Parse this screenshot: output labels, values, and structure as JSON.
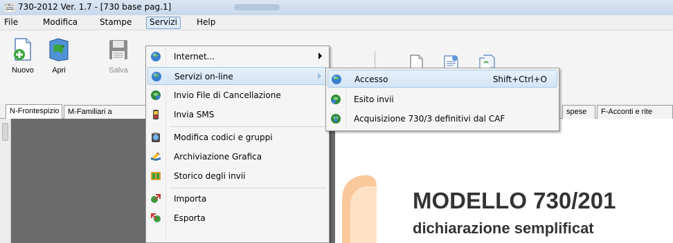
{
  "window": {
    "title": "730-2012 Ver. 1.7 - [730 base pag.1]"
  },
  "menubar": {
    "items": [
      {
        "label": "File"
      },
      {
        "label": "Modifica"
      },
      {
        "label": "Stampe"
      },
      {
        "label": "Servizi"
      },
      {
        "label": "Help"
      }
    ]
  },
  "toolbar": {
    "nuovo": "Nuovo",
    "apri": "Apri",
    "salva": "Salva"
  },
  "tabs": {
    "items": [
      {
        "label": "N-Frontespizio"
      },
      {
        "label": "M-Familiari a"
      },
      {
        "label": "spese"
      },
      {
        "label": "F-Acconti e rite"
      }
    ]
  },
  "servizi_menu": {
    "items": [
      {
        "label": "Internet...",
        "icon": "globe-icon"
      },
      {
        "label": "Servizi on-line",
        "icon": "globe-icon"
      },
      {
        "label": "Invio File di Cancellazione",
        "icon": "globe-send-icon"
      },
      {
        "label": "Invia SMS",
        "icon": "phone-icon"
      },
      {
        "label": "Modifica codici e gruppi",
        "icon": "edit-codes-icon"
      },
      {
        "label": "Archiviazione Grafica",
        "icon": "archive-icon"
      },
      {
        "label": "Storico degli invii",
        "icon": "history-icon"
      },
      {
        "label": "Importa",
        "icon": "import-icon"
      },
      {
        "label": "Esporta",
        "icon": "export-icon"
      }
    ]
  },
  "online_submenu": {
    "items": [
      {
        "label": "Accesso",
        "shortcut": "Shift+Ctrl+O",
        "icon": "globe-icon"
      },
      {
        "label": "Esito invii",
        "icon": "globe-result-icon"
      },
      {
        "label": "Acquisizione 730/3 definitivi dal CAF",
        "icon": "globe-download-icon"
      }
    ]
  },
  "document": {
    "title": "MODELLO 730/201",
    "subtitle": "dichiarazione semplificat"
  },
  "colors": {
    "menu_highlight": "#d4e5f7",
    "workspace_gray": "#6b6b6b",
    "decor_orange": "#f5a04a",
    "doc_text": "#333333"
  }
}
